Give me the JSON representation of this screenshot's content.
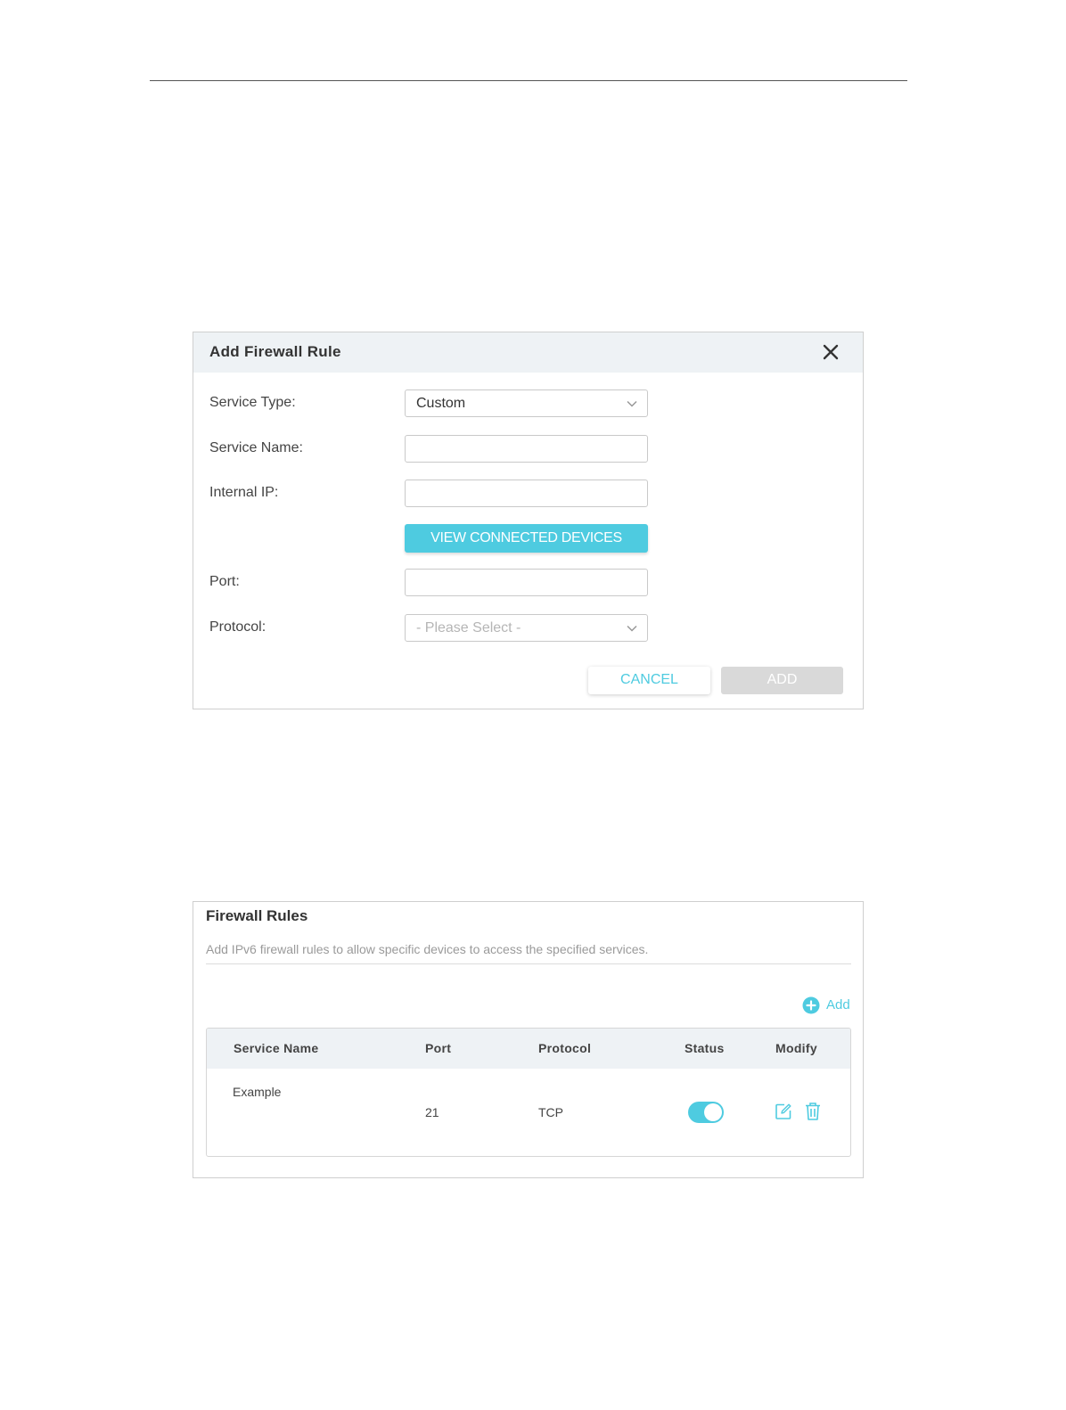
{
  "dialog": {
    "title": "Add Firewall Rule",
    "fields": {
      "service_type": {
        "label": "Service Type:",
        "value": "Custom"
      },
      "service_name": {
        "label": "Service Name:",
        "value": ""
      },
      "internal_ip": {
        "label": "Internal IP:",
        "value": ""
      },
      "port": {
        "label": "Port:",
        "value": ""
      },
      "protocol": {
        "label": "Protocol:",
        "placeholder": "- Please Select -"
      }
    },
    "view_devices_label": "VIEW CONNECTED DEVICES",
    "cancel_label": "CANCEL",
    "add_label": "ADD"
  },
  "rules": {
    "title": "Firewall Rules",
    "description": "Add IPv6 firewall rules to allow specific devices to access the specified services.",
    "add_label": "Add",
    "columns": [
      "Service Name",
      "Port",
      "Protocol",
      "Status",
      "Modify"
    ],
    "rows": [
      {
        "service_name": "Example",
        "port": "21",
        "protocol": "TCP",
        "status": "on"
      }
    ]
  },
  "colors": {
    "accent": "#4ecbe0",
    "disabled": "#d9d9d9",
    "header_bg": "#eef2f5"
  }
}
